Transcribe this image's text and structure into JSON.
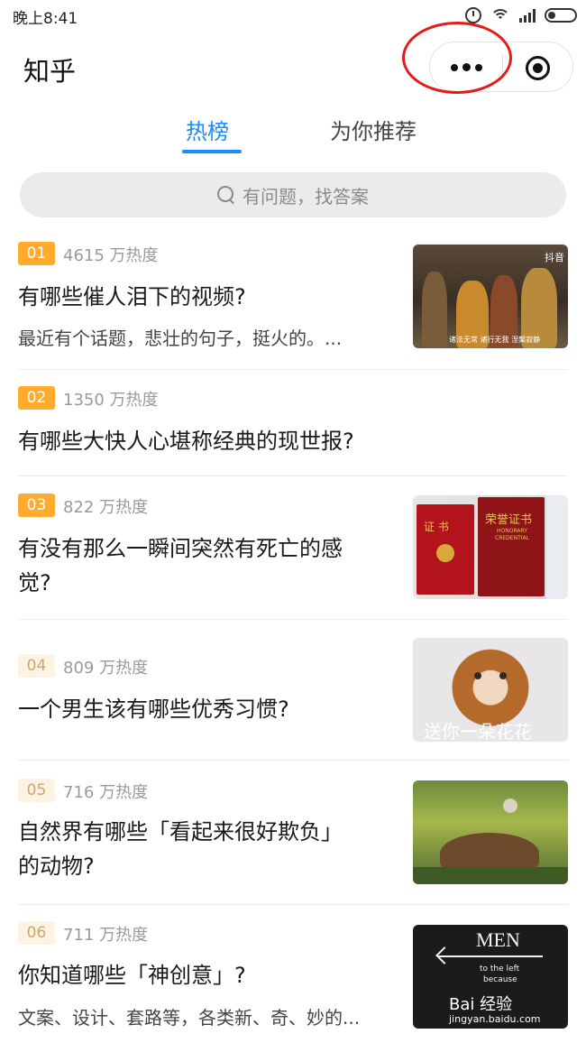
{
  "status_bar": {
    "time": "晚上8:41"
  },
  "header": {
    "title": "知乎"
  },
  "tabs": [
    {
      "label": "热榜",
      "active": true
    },
    {
      "label": "为你推荐",
      "active": false
    }
  ],
  "search": {
    "placeholder": "有问题，找答案"
  },
  "items": [
    {
      "rank": "01",
      "heat": "4615 万热度",
      "title_lines": [
        "有哪些催人泪下的视频?"
      ],
      "excerpt": "最近有个话题，悲壮的句子，挺火的。...",
      "thumb_caption": "诸法无常 诸行无我 涅槃寂静",
      "thumb_tag": "抖音"
    },
    {
      "rank": "02",
      "heat": "1350 万热度",
      "title_lines": [
        "有哪些大快人心堪称经典的现世报?"
      ],
      "excerpt": ""
    },
    {
      "rank": "03",
      "heat": "822 万热度",
      "title_lines": [
        "有没有那么一瞬间突然有死亡的感",
        "觉?"
      ],
      "excerpt": "",
      "thumb_book1": "证 书",
      "thumb_book2": "荣誉证书",
      "thumb_book2_en": "HONORARY CREDENTIAL"
    },
    {
      "rank": "04",
      "heat": "809 万热度",
      "title_lines": [
        "一个男生该有哪些优秀习惯?"
      ],
      "excerpt": "",
      "thumb_caption": "送你一朵花花"
    },
    {
      "rank": "05",
      "heat": "716 万热度",
      "title_lines": [
        "自然界有哪些「看起来很好欺负」",
        "的动物?"
      ],
      "excerpt": ""
    },
    {
      "rank": "06",
      "heat": "711 万热度",
      "title_lines": [
        "你知道哪些「神创意」?"
      ],
      "excerpt": "文案、设计、套路等，各类新、奇、妙的...",
      "thumb_sign_top": "MEN",
      "thumb_sign_mid": "to the left",
      "thumb_sign_low": "because",
      "thumb_watermark": "Bai 经验",
      "thumb_watermark_url": "jingyan.baidu.com"
    }
  ],
  "colors": {
    "accent": "#1a8cff",
    "rank_top": "#ffab2e",
    "annotation": "#e41b1b"
  }
}
